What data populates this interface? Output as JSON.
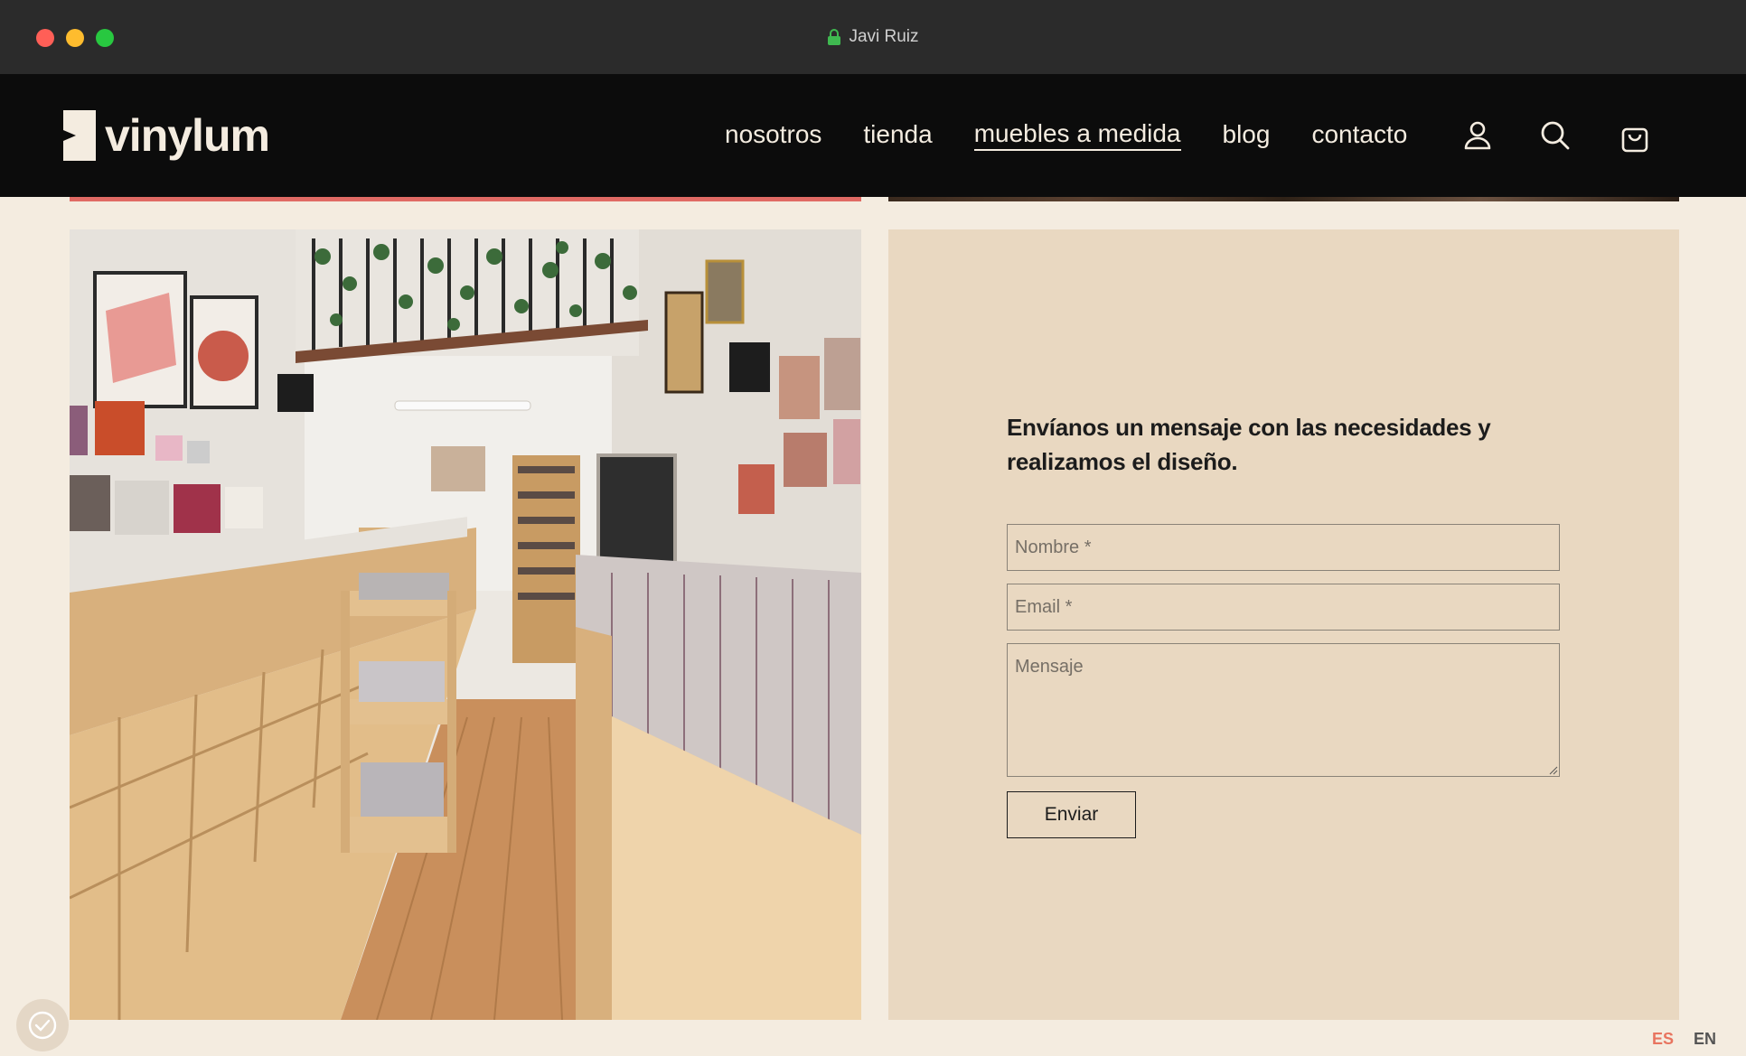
{
  "browser": {
    "title": "Javi Ruiz"
  },
  "brand": {
    "name": "vinylum"
  },
  "nav": {
    "items": [
      {
        "label": "nosotros"
      },
      {
        "label": "tienda"
      },
      {
        "label": "muebles a medida",
        "active": true
      },
      {
        "label": "blog"
      },
      {
        "label": "contacto"
      }
    ],
    "icons": [
      "user-icon",
      "search-icon",
      "cart-icon"
    ]
  },
  "form": {
    "heading": "Envíanos un mensaje con las necesidades y realizamos el diseño.",
    "name_placeholder": "Nombre *",
    "email_placeholder": "Email *",
    "message_placeholder": "Mensaje",
    "submit_label": "Enviar"
  },
  "language": {
    "options": [
      "ES",
      "EN"
    ],
    "selected": "ES"
  },
  "colors": {
    "header": "#0c0c0c",
    "page": "#f4ece0",
    "panel": "#e9d8c1",
    "accent": "#e06a64",
    "lang_active": "#e8745f"
  }
}
